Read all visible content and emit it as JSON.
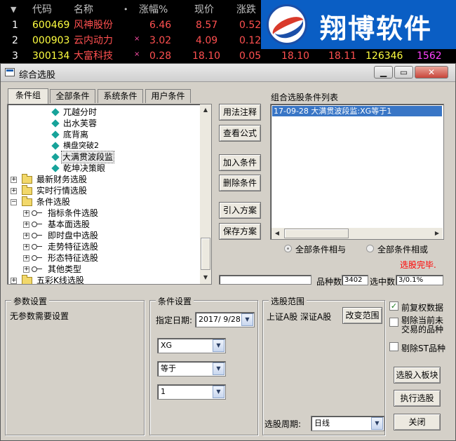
{
  "quote": {
    "headers": {
      "sort": "▼",
      "code": "代码",
      "name": "名称",
      "dot": "•",
      "change_pct": "涨幅%",
      "price": "现价",
      "change": "涨跌"
    },
    "rows": [
      {
        "no": "1",
        "code": "600469",
        "name": "风神股份",
        "mark": "",
        "change_pct": "6.46",
        "price": "8.57",
        "change": "0.52"
      },
      {
        "no": "2",
        "code": "000903",
        "name": "云内动力",
        "mark": "×",
        "change_pct": "3.02",
        "price": "4.09",
        "change": "0.12"
      },
      {
        "no": "3",
        "code": "300134",
        "name": "大富科技",
        "mark": "×",
        "change_pct": "0.28",
        "price": "18.10",
        "change": "0.05",
        "buy": "18.10",
        "sell": "18.11",
        "volume": "126346",
        "cur": "1562"
      }
    ]
  },
  "logo": {
    "text": "翔博软件"
  },
  "window": {
    "title": "综合选股",
    "min": "▁",
    "max": "▭",
    "close": "✕"
  },
  "tabs": [
    "条件组",
    "全部条件",
    "系统条件",
    "用户条件"
  ],
  "tree": [
    {
      "label": "兀越分时",
      "type": "leaf"
    },
    {
      "label": "出水芙蓉",
      "type": "leaf"
    },
    {
      "label": "底背离",
      "type": "leaf"
    },
    {
      "label": "横盘突破2",
      "type": "leaf"
    },
    {
      "label": "大满贯波段监",
      "type": "leaf",
      "selected": true
    },
    {
      "label": "乾坤决策眼",
      "type": "leaf"
    },
    {
      "label": "最新财务选股",
      "type": "folder"
    },
    {
      "label": "实时行情选股",
      "type": "folder"
    },
    {
      "label": "条件选股",
      "type": "folder-open"
    },
    {
      "label": "指标条件选股",
      "type": "key"
    },
    {
      "label": "基本面选股",
      "type": "key"
    },
    {
      "label": "即时盘中选股",
      "type": "key"
    },
    {
      "label": "走势特征选股",
      "type": "key"
    },
    {
      "label": "形态特征选股",
      "type": "key"
    },
    {
      "label": "其他类型",
      "type": "key"
    },
    {
      "label": "五彩K线选股",
      "type": "folder"
    }
  ],
  "tree_symbols": {
    "plus": "+",
    "minus": "−",
    "up": "▲",
    "down": "▼",
    "left": "◀",
    "right": "▶"
  },
  "middle_buttons": {
    "usage": "用法注释",
    "formula": "查看公式",
    "add": "加入条件",
    "delete": "删除条件",
    "import": "引入方案",
    "save": "保存方案"
  },
  "condition_list": {
    "title": "组合选股条件列表",
    "items": [
      "17-09-28 大满贯波段监:XG等于1"
    ]
  },
  "logic": {
    "and_label": "全部条件相与",
    "or_label": "全部条件相或"
  },
  "status": {
    "done": "选股完毕.",
    "count_label": "品种数",
    "count_value": "3402",
    "selected_label": "选中数",
    "selected_value": "3/0.1%"
  },
  "params": {
    "title": "参数设置",
    "text": "无参数需要设置"
  },
  "cond_settings": {
    "title": "条件设置",
    "date_label": "指定日期:",
    "date_value": "2017/ 9/28",
    "var_value": "XG",
    "op_value": "等于",
    "num_value": "1"
  },
  "scope": {
    "title": "选股范围",
    "value": "上证A股  深证A股",
    "change_btn": "改变范围",
    "period_label": "选股周期:",
    "period_value": "日线"
  },
  "options": {
    "restore": {
      "label": "前复权数据",
      "checked": true
    },
    "exclude_halt": {
      "label": "剔除当前未交易的品种",
      "checked": false
    },
    "exclude_st": {
      "label": "剔除ST品种",
      "checked": false
    }
  },
  "bottom_buttons": {
    "to_block": "选股入板块",
    "execute": "执行选股",
    "close": "关闭"
  },
  "colors": {
    "accent_red": "#ff0000",
    "selection": "#3976c6",
    "up": "#ff5050",
    "code": "#ffff40"
  }
}
